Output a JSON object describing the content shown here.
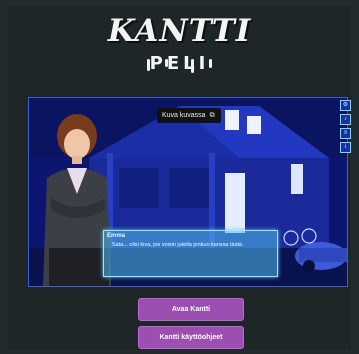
{
  "logo": {
    "title": "KANTTI",
    "subtitle": "PELI"
  },
  "tooltip": {
    "label": "Kuva kuvassa",
    "icon": "picture-in-picture-icon"
  },
  "side_buttons": [
    "settings-icon",
    "sound-icon",
    "text-icon",
    "info-icon"
  ],
  "dialog": {
    "speaker": "Emma",
    "text": "Sata... olisi kiva, jos voisin jutella jonkun kanssa tästä."
  },
  "buttons": {
    "open": "Avaa Kantti",
    "guide": "Kantti käyttöohjeet"
  },
  "colors": {
    "background": "#222c2e",
    "scene": "#0d1a78",
    "dialog": "#50bef0",
    "button": "#9a4fb1"
  }
}
